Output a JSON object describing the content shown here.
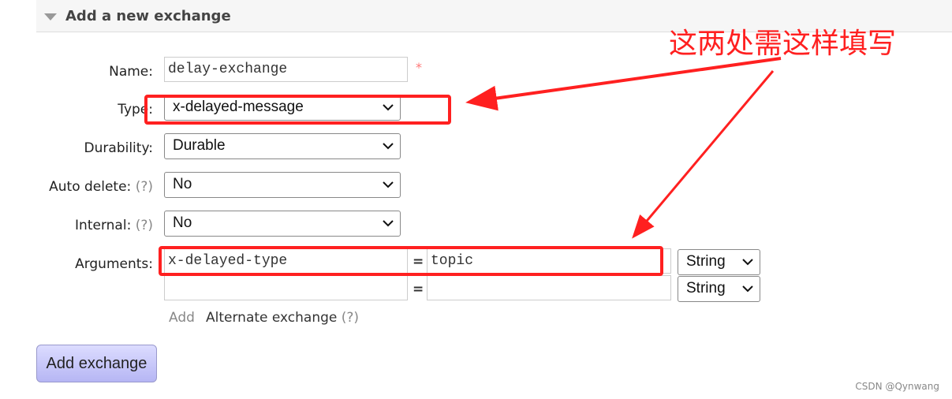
{
  "section": {
    "title": "Add a new exchange"
  },
  "form": {
    "name": {
      "label": "Name:",
      "value": "delay-exchange",
      "required_mark": "*"
    },
    "type": {
      "label": "Type:",
      "value": "x-delayed-message"
    },
    "durability": {
      "label": "Durability:",
      "value": "Durable"
    },
    "auto_delete": {
      "label": "Auto delete:",
      "help": "(?)",
      "value": "No"
    },
    "internal": {
      "label": "Internal:",
      "help": "(?)",
      "value": "No"
    },
    "arguments": {
      "label": "Arguments:",
      "rows": [
        {
          "key": "x-delayed-type",
          "eq": "=",
          "value": "topic",
          "type": "String"
        },
        {
          "key": "",
          "eq": "=",
          "value": "",
          "type": "String"
        }
      ],
      "add_label": "Add",
      "alternate_label": "Alternate exchange",
      "alternate_help": "(?)"
    },
    "submit_label": "Add exchange"
  },
  "annotation": {
    "text": "这两处需这样填写",
    "color": "#ff2020"
  },
  "watermark": "CSDN @Qynwang"
}
